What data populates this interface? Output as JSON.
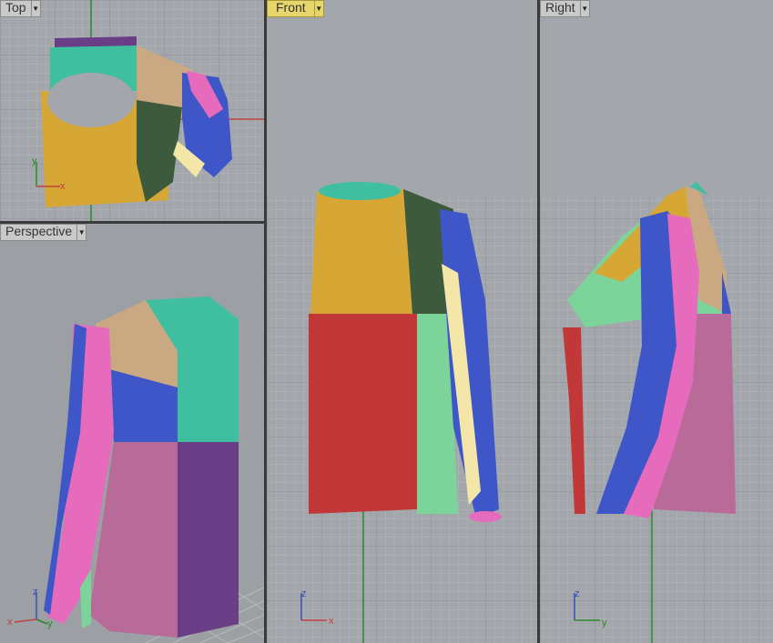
{
  "viewports": {
    "top": {
      "label": "Top",
      "dropdown_icon": "chevron-down-icon"
    },
    "front": {
      "label": "Front",
      "dropdown_icon": "chevron-down-icon"
    },
    "right": {
      "label": "Right",
      "dropdown_icon": "chevron-down-icon"
    },
    "perspective": {
      "label": "Perspective",
      "dropdown_icon": "chevron-down-icon"
    }
  },
  "axis_labels": {
    "x": "x",
    "y": "y",
    "z": "z"
  },
  "colors": {
    "viewport_bg": "#a3a7ab",
    "grid_minor": "#b4b8bc",
    "grid_major": "#8d9196",
    "active_tab": "#e6d66c",
    "axis_x": "#c04040",
    "axis_y": "#2a8a2a",
    "axis_z": "#3a4fb0",
    "panel_yellow": "#d6a734",
    "panel_tan": "#caa882",
    "panel_teal": "#3fbf9f",
    "panel_red": "#c23838",
    "panel_green": "#7cd49a",
    "panel_blue": "#3e56c8",
    "panel_pink": "#e76bbd",
    "panel_plum": "#b86a98",
    "panel_darkgreen": "#3d5a3c",
    "panel_purple": "#6a3e86"
  }
}
